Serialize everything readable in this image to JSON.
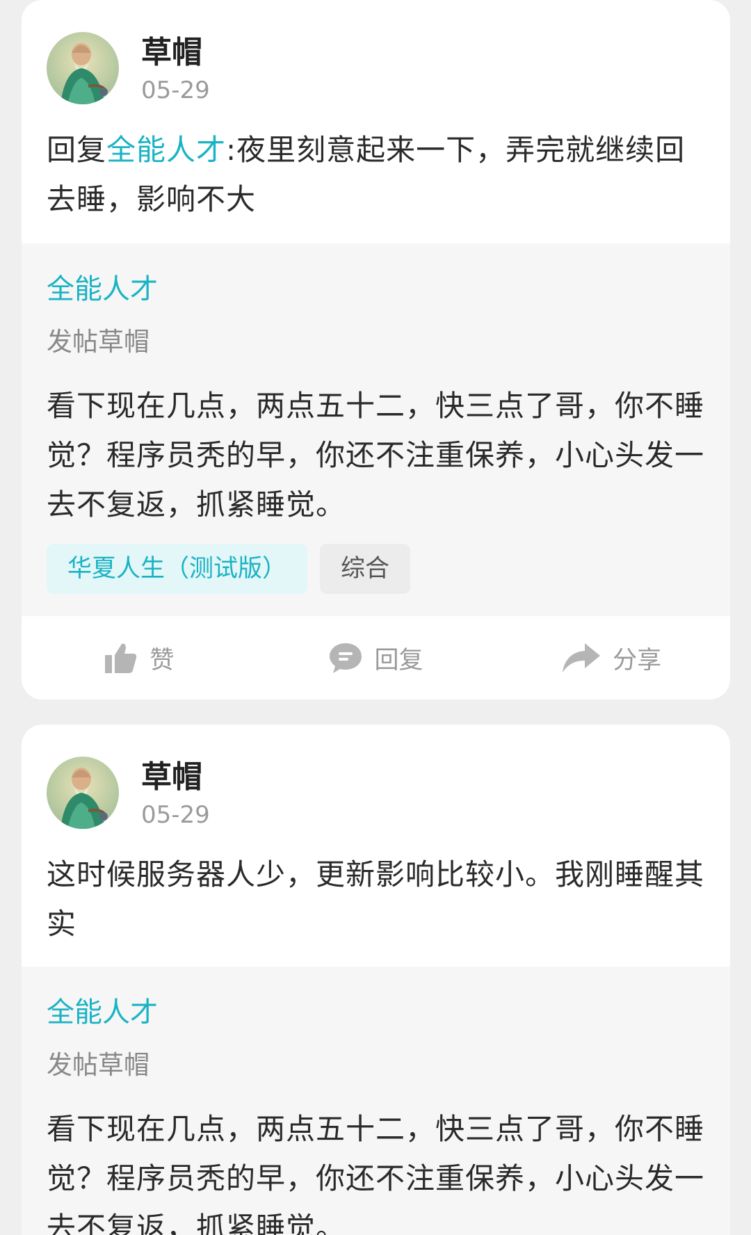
{
  "posts": [
    {
      "author": {
        "name": "草帽",
        "date": "05-29"
      },
      "reply": {
        "prefix": "回复",
        "mention": "全能人才",
        "text": ":夜里刻意起来一下，弄完就继续回去睡，影响不大"
      },
      "quoted": {
        "author": "全能人才",
        "title": "发帖草帽",
        "body": "看下现在几点，两点五十二，快三点了哥，你不睡觉？程序员秃的早，你还不注重保养，小心头发一去不复返，抓紧睡觉。",
        "tags": [
          "华夏人生（测试版）",
          "综合"
        ]
      },
      "actions": {
        "like": "赞",
        "reply": "回复",
        "share": "分享"
      }
    },
    {
      "author": {
        "name": "草帽",
        "date": "05-29"
      },
      "reply": {
        "text": "这时候服务器人少，更新影响比较小。我刚睡醒其实"
      },
      "quoted": {
        "author": "全能人才",
        "title": "发帖草帽",
        "body": "看下现在几点，两点五十二，快三点了哥，你不睡觉？程序员秃的早，你还不注重保养，小心头发一去不复返，抓紧睡觉。"
      }
    }
  ],
  "colors": {
    "accent": "#1ab3c4",
    "background": "#efefef",
    "card": "#ffffff",
    "quoted_bg": "#f6f6f6",
    "muted": "#9a9a9a"
  },
  "icons": [
    "avatar-image",
    "thumbs-up-icon",
    "comment-icon",
    "share-arrow-icon"
  ]
}
